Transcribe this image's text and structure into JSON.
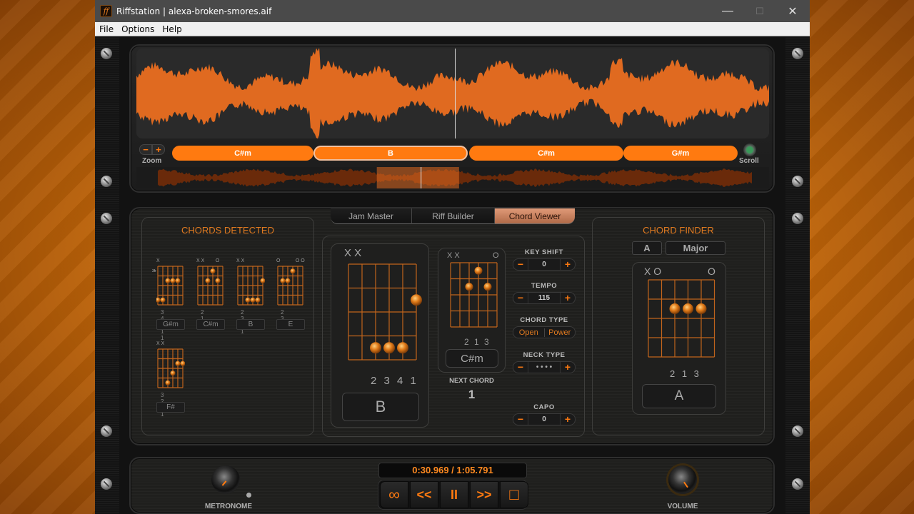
{
  "window": {
    "title": "Riffstation | alexa-broken-smores.aif",
    "icon": "ff",
    "minimize": "—",
    "maximize": "☐",
    "close": "✕"
  },
  "menu": [
    "File",
    "Options",
    "Help"
  ],
  "waveform": {
    "zoom_label": "Zoom",
    "zoom_minus": "−",
    "zoom_plus": "+",
    "scroll_label": "Scroll",
    "playhead_fraction": 0.503,
    "chords": [
      {
        "name": "C#m",
        "active": false
      },
      {
        "name": "B",
        "active": true
      },
      {
        "name": "C#m",
        "active": false
      },
      {
        "name": "G#m",
        "active": false
      }
    ],
    "minimap_view": {
      "start": 0.38,
      "end": 0.51,
      "playhead": 0.45
    }
  },
  "tabs": [
    {
      "label": "Jam Master",
      "active": false
    },
    {
      "label": "Riff Builder",
      "active": false
    },
    {
      "label": "Chord Viewer",
      "active": true
    }
  ],
  "chords_detected": {
    "title": "CHORDS DETECTED",
    "items": [
      {
        "name": "G#m",
        "top": "X",
        "fret_label": "3fr",
        "fingers": "3 4 1 1 1",
        "dots": [
          [
            0,
            3
          ],
          [
            1,
            3
          ],
          [
            2,
            1
          ],
          [
            3,
            1
          ],
          [
            4,
            1
          ]
        ]
      },
      {
        "name": "C#m",
        "top": "X X        O",
        "fingers": "2 1 3",
        "dots": [
          [
            2,
            1
          ],
          [
            3,
            0
          ],
          [
            4,
            1
          ]
        ]
      },
      {
        "name": "B",
        "top": "X X",
        "fingers": "2 3 4 1",
        "dots": [
          [
            2,
            3
          ],
          [
            3,
            3
          ],
          [
            4,
            3
          ],
          [
            5,
            1
          ]
        ]
      },
      {
        "name": "E",
        "top": "O           O O",
        "fingers": "2 3 1",
        "dots": [
          [
            1,
            1
          ],
          [
            2,
            1
          ],
          [
            3,
            0
          ]
        ]
      },
      {
        "name": "F#",
        "top": "X X",
        "fingers": "3 2 1 1",
        "dots": [
          [
            2,
            3
          ],
          [
            3,
            2
          ],
          [
            4,
            1
          ],
          [
            5,
            1
          ]
        ]
      }
    ]
  },
  "chord_viewer": {
    "current": {
      "name": "B",
      "top": "X X",
      "fingers": "2 3 4 1",
      "dots": [
        [
          2,
          3
        ],
        [
          3,
          3
        ],
        [
          4,
          3
        ],
        [
          5,
          1
        ]
      ]
    },
    "next": {
      "name": "C#m",
      "top_left": "X X",
      "top_right": "O",
      "fingers": "2 1 3",
      "dots": [
        [
          2,
          1
        ],
        [
          3,
          0
        ],
        [
          4,
          1
        ]
      ]
    },
    "next_label": "NEXT CHORD",
    "next_count": "1"
  },
  "controls": {
    "key_shift": {
      "label": "KEY SHIFT",
      "value": "0"
    },
    "tempo": {
      "label": "TEMPO",
      "value": "115"
    },
    "chord_type": {
      "label": "CHORD TYPE",
      "options": [
        "Open",
        "Power"
      ]
    },
    "neck_type": {
      "label": "NECK TYPE",
      "value": "• • • •"
    },
    "capo": {
      "label": "CAPO",
      "value": "0"
    },
    "minus": "−",
    "plus": "+"
  },
  "chord_finder": {
    "title": "CHORD FINDER",
    "root": "A",
    "quality": "Major",
    "top_left": "X O",
    "top_right": "O",
    "fingers": "2 1 3",
    "name": "A",
    "dots": [
      [
        2,
        1
      ],
      [
        3,
        1
      ],
      [
        4,
        1
      ]
    ]
  },
  "transport": {
    "time": "0:30.969 / 1:05.791",
    "loop": "∞",
    "rewind": "<<",
    "pause": "II",
    "forward": ">>",
    "stop": "□",
    "metronome_label": "METRONOME",
    "volume_label": "VOLUME",
    "volume_level": 0.75,
    "metronome_level": 0.1
  },
  "colors": {
    "accent": "#ff7a10",
    "waveform": "#e06a20"
  }
}
